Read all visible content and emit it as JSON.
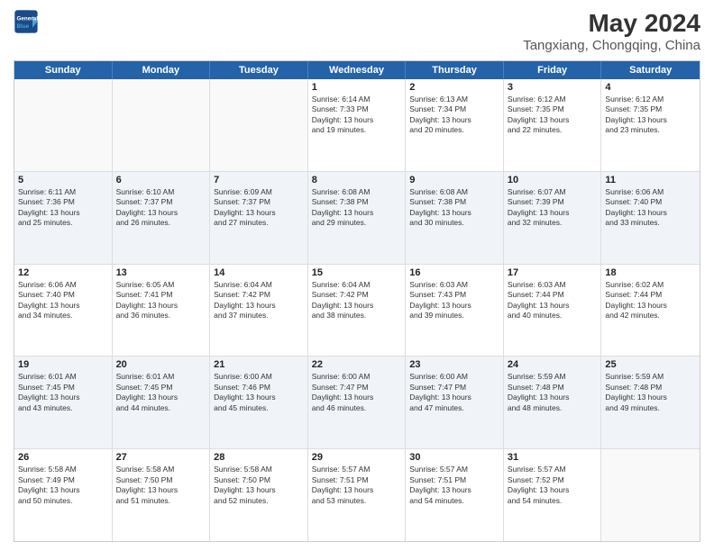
{
  "header": {
    "logo_line1": "General",
    "logo_line2": "Blue",
    "title": "May 2024",
    "subtitle": "Tangxiang, Chongqing, China"
  },
  "weekdays": [
    "Sunday",
    "Monday",
    "Tuesday",
    "Wednesday",
    "Thursday",
    "Friday",
    "Saturday"
  ],
  "rows": [
    {
      "alt": false,
      "cells": [
        {
          "day": "",
          "lines": []
        },
        {
          "day": "",
          "lines": []
        },
        {
          "day": "",
          "lines": []
        },
        {
          "day": "1",
          "lines": [
            "Sunrise: 6:14 AM",
            "Sunset: 7:33 PM",
            "Daylight: 13 hours",
            "and 19 minutes."
          ]
        },
        {
          "day": "2",
          "lines": [
            "Sunrise: 6:13 AM",
            "Sunset: 7:34 PM",
            "Daylight: 13 hours",
            "and 20 minutes."
          ]
        },
        {
          "day": "3",
          "lines": [
            "Sunrise: 6:12 AM",
            "Sunset: 7:35 PM",
            "Daylight: 13 hours",
            "and 22 minutes."
          ]
        },
        {
          "day": "4",
          "lines": [
            "Sunrise: 6:12 AM",
            "Sunset: 7:35 PM",
            "Daylight: 13 hours",
            "and 23 minutes."
          ]
        }
      ]
    },
    {
      "alt": true,
      "cells": [
        {
          "day": "5",
          "lines": [
            "Sunrise: 6:11 AM",
            "Sunset: 7:36 PM",
            "Daylight: 13 hours",
            "and 25 minutes."
          ]
        },
        {
          "day": "6",
          "lines": [
            "Sunrise: 6:10 AM",
            "Sunset: 7:37 PM",
            "Daylight: 13 hours",
            "and 26 minutes."
          ]
        },
        {
          "day": "7",
          "lines": [
            "Sunrise: 6:09 AM",
            "Sunset: 7:37 PM",
            "Daylight: 13 hours",
            "and 27 minutes."
          ]
        },
        {
          "day": "8",
          "lines": [
            "Sunrise: 6:08 AM",
            "Sunset: 7:38 PM",
            "Daylight: 13 hours",
            "and 29 minutes."
          ]
        },
        {
          "day": "9",
          "lines": [
            "Sunrise: 6:08 AM",
            "Sunset: 7:38 PM",
            "Daylight: 13 hours",
            "and 30 minutes."
          ]
        },
        {
          "day": "10",
          "lines": [
            "Sunrise: 6:07 AM",
            "Sunset: 7:39 PM",
            "Daylight: 13 hours",
            "and 32 minutes."
          ]
        },
        {
          "day": "11",
          "lines": [
            "Sunrise: 6:06 AM",
            "Sunset: 7:40 PM",
            "Daylight: 13 hours",
            "and 33 minutes."
          ]
        }
      ]
    },
    {
      "alt": false,
      "cells": [
        {
          "day": "12",
          "lines": [
            "Sunrise: 6:06 AM",
            "Sunset: 7:40 PM",
            "Daylight: 13 hours",
            "and 34 minutes."
          ]
        },
        {
          "day": "13",
          "lines": [
            "Sunrise: 6:05 AM",
            "Sunset: 7:41 PM",
            "Daylight: 13 hours",
            "and 36 minutes."
          ]
        },
        {
          "day": "14",
          "lines": [
            "Sunrise: 6:04 AM",
            "Sunset: 7:42 PM",
            "Daylight: 13 hours",
            "and 37 minutes."
          ]
        },
        {
          "day": "15",
          "lines": [
            "Sunrise: 6:04 AM",
            "Sunset: 7:42 PM",
            "Daylight: 13 hours",
            "and 38 minutes."
          ]
        },
        {
          "day": "16",
          "lines": [
            "Sunrise: 6:03 AM",
            "Sunset: 7:43 PM",
            "Daylight: 13 hours",
            "and 39 minutes."
          ]
        },
        {
          "day": "17",
          "lines": [
            "Sunrise: 6:03 AM",
            "Sunset: 7:44 PM",
            "Daylight: 13 hours",
            "and 40 minutes."
          ]
        },
        {
          "day": "18",
          "lines": [
            "Sunrise: 6:02 AM",
            "Sunset: 7:44 PM",
            "Daylight: 13 hours",
            "and 42 minutes."
          ]
        }
      ]
    },
    {
      "alt": true,
      "cells": [
        {
          "day": "19",
          "lines": [
            "Sunrise: 6:01 AM",
            "Sunset: 7:45 PM",
            "Daylight: 13 hours",
            "and 43 minutes."
          ]
        },
        {
          "day": "20",
          "lines": [
            "Sunrise: 6:01 AM",
            "Sunset: 7:45 PM",
            "Daylight: 13 hours",
            "and 44 minutes."
          ]
        },
        {
          "day": "21",
          "lines": [
            "Sunrise: 6:00 AM",
            "Sunset: 7:46 PM",
            "Daylight: 13 hours",
            "and 45 minutes."
          ]
        },
        {
          "day": "22",
          "lines": [
            "Sunrise: 6:00 AM",
            "Sunset: 7:47 PM",
            "Daylight: 13 hours",
            "and 46 minutes."
          ]
        },
        {
          "day": "23",
          "lines": [
            "Sunrise: 6:00 AM",
            "Sunset: 7:47 PM",
            "Daylight: 13 hours",
            "and 47 minutes."
          ]
        },
        {
          "day": "24",
          "lines": [
            "Sunrise: 5:59 AM",
            "Sunset: 7:48 PM",
            "Daylight: 13 hours",
            "and 48 minutes."
          ]
        },
        {
          "day": "25",
          "lines": [
            "Sunrise: 5:59 AM",
            "Sunset: 7:48 PM",
            "Daylight: 13 hours",
            "and 49 minutes."
          ]
        }
      ]
    },
    {
      "alt": false,
      "cells": [
        {
          "day": "26",
          "lines": [
            "Sunrise: 5:58 AM",
            "Sunset: 7:49 PM",
            "Daylight: 13 hours",
            "and 50 minutes."
          ]
        },
        {
          "day": "27",
          "lines": [
            "Sunrise: 5:58 AM",
            "Sunset: 7:50 PM",
            "Daylight: 13 hours",
            "and 51 minutes."
          ]
        },
        {
          "day": "28",
          "lines": [
            "Sunrise: 5:58 AM",
            "Sunset: 7:50 PM",
            "Daylight: 13 hours",
            "and 52 minutes."
          ]
        },
        {
          "day": "29",
          "lines": [
            "Sunrise: 5:57 AM",
            "Sunset: 7:51 PM",
            "Daylight: 13 hours",
            "and 53 minutes."
          ]
        },
        {
          "day": "30",
          "lines": [
            "Sunrise: 5:57 AM",
            "Sunset: 7:51 PM",
            "Daylight: 13 hours",
            "and 54 minutes."
          ]
        },
        {
          "day": "31",
          "lines": [
            "Sunrise: 5:57 AM",
            "Sunset: 7:52 PM",
            "Daylight: 13 hours",
            "and 54 minutes."
          ]
        },
        {
          "day": "",
          "lines": []
        }
      ]
    }
  ]
}
